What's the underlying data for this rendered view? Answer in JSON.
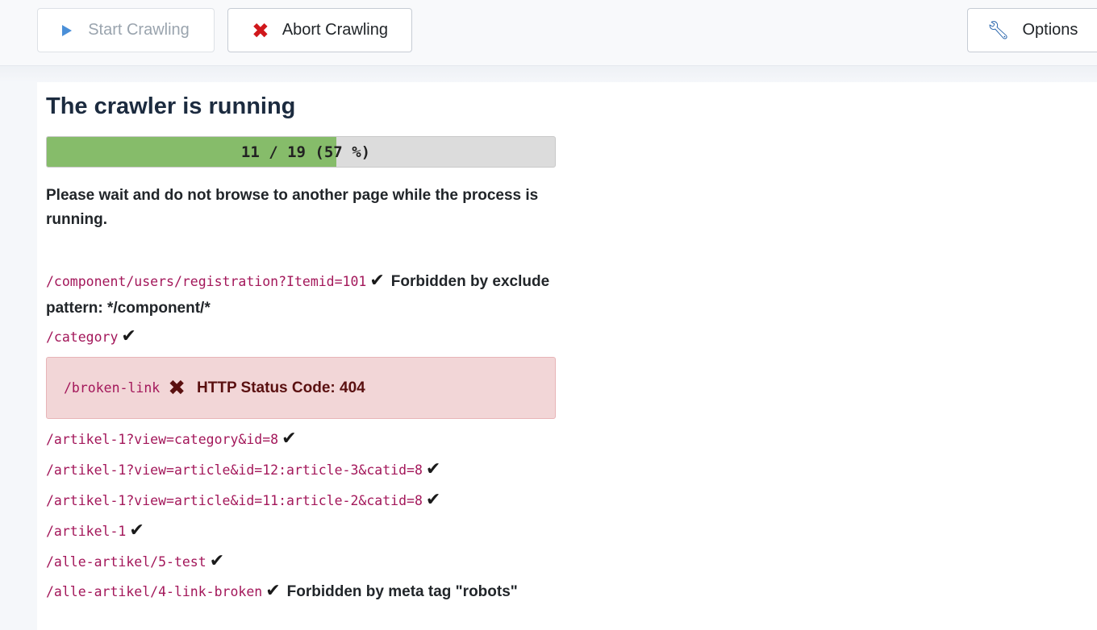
{
  "toolbar": {
    "start_label": "Start Crawling",
    "abort_label": "Abort Crawling",
    "options_label": "Options"
  },
  "main": {
    "title": "The crawler is running",
    "progress": {
      "done": 11,
      "total": 19,
      "percent": 57,
      "label": "11 / 19 (57 %)"
    },
    "wait_message": "Please wait and do not browse to another page while the process is running."
  },
  "log": [
    {
      "url": "/component/users/registration?Itemid=101",
      "status": "ok",
      "message": "Forbidden by exclude pattern: */component/*"
    },
    {
      "url": "/category",
      "status": "ok",
      "message": ""
    },
    {
      "url": "/broken-link",
      "status": "error",
      "message": "HTTP Status Code: 404"
    },
    {
      "url": "/artikel-1?view=category&id=8",
      "status": "ok",
      "message": ""
    },
    {
      "url": "/artikel-1?view=article&id=12:article-3&catid=8",
      "status": "ok",
      "message": ""
    },
    {
      "url": "/artikel-1?view=article&id=11:article-2&catid=8",
      "status": "ok",
      "message": ""
    },
    {
      "url": "/artikel-1",
      "status": "ok",
      "message": ""
    },
    {
      "url": "/alle-artikel/5-test",
      "status": "ok",
      "message": ""
    },
    {
      "url": "/alle-artikel/4-link-broken",
      "status": "ok",
      "message": "Forbidden by meta tag \"robots\""
    }
  ],
  "colors": {
    "progress_fill": "#86bc6a",
    "url": "#a3175a",
    "error_bg": "#f2d6d7"
  },
  "icons": {
    "start": "play-icon",
    "abort": "close-icon",
    "options": "wrench-icon",
    "ok": "checkmark-icon",
    "error": "x-mark-icon"
  }
}
